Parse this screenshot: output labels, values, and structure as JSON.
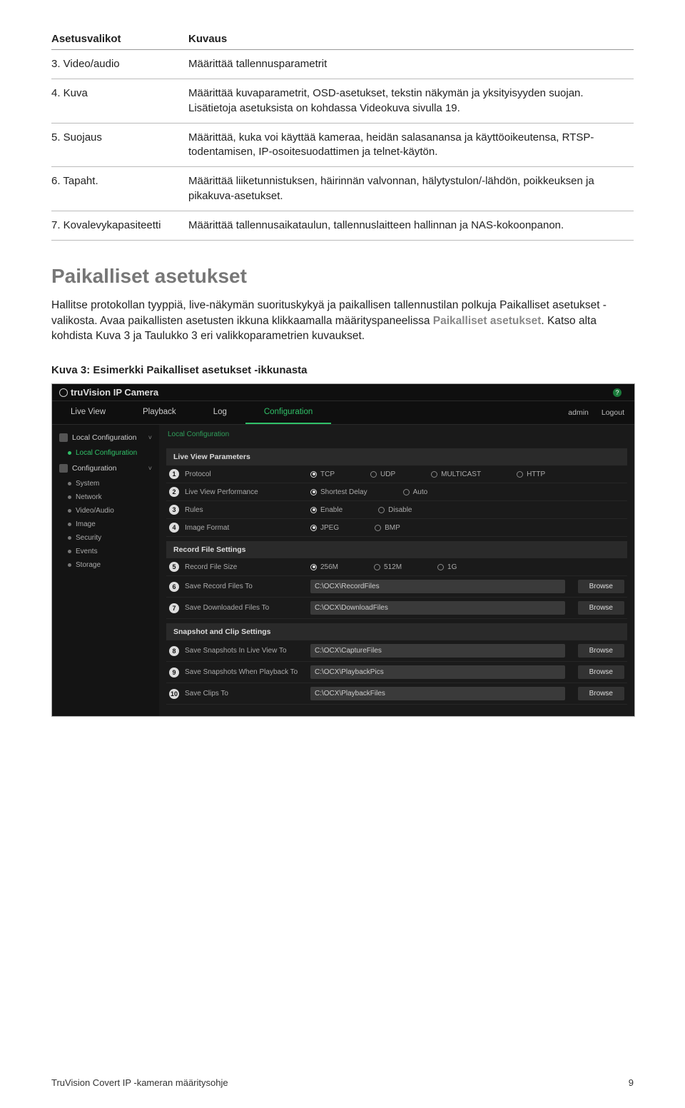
{
  "table": {
    "head1": "Asetusvalikot",
    "head2": "Kuvaus",
    "rows": [
      {
        "c1": "3. Video/audio",
        "c2": "Määrittää tallennusparametrit"
      },
      {
        "c1": "4. Kuva",
        "c2": "Määrittää kuvaparametrit, OSD-asetukset, tekstin näkymän ja yksityisyyden suojan. Lisätietoja asetuksista on kohdassa Videokuva sivulla 19."
      },
      {
        "c1": "5. Suojaus",
        "c2": "Määrittää, kuka voi käyttää kameraa, heidän salasanansa ja käyttöoikeutensa, RTSP-todentamisen, IP-osoitesuodattimen ja telnet-käytön."
      },
      {
        "c1": "6. Tapaht.",
        "c2": "Määrittää liiketunnistuksen, häirinnän valvonnan, hälytystulon/-lähdön, poikkeuksen ja pikakuva-asetukset."
      },
      {
        "c1": "7. Kovalevykapasiteetti",
        "c2": "Määrittää tallennusaikataulun, tallennuslaitteen hallinnan ja NAS-kokoonpanon."
      }
    ]
  },
  "section_title": "Paikalliset asetukset",
  "para_a": "Hallitse protokollan tyyppiä, live-näkymän suorituskykyä ja paikallisen tallennustilan polkuja Paikalliset asetukset -valikosta. Avaa paikallisten asetusten ikkuna klikkaamalla määrityspaneelissa ",
  "para_bold": "Paikalliset asetukset",
  "para_b": ". Katso alta kohdista Kuva 3 ja Taulukko 3 eri valikkoparametrien kuvaukset.",
  "fig_caption": "Kuva 3: Esimerkki Paikalliset asetukset -ikkunasta",
  "shot": {
    "logo": "truVision  IP Camera",
    "tabs": {
      "live": "Live View",
      "play": "Playback",
      "log": "Log",
      "conf": "Configuration"
    },
    "user": "admin",
    "logout": "Logout",
    "side": {
      "local": "Local Configuration",
      "local_item": "Local Configuration",
      "config": "Configuration",
      "items": [
        "System",
        "Network",
        "Video/Audio",
        "Image",
        "Security",
        "Events",
        "Storage"
      ]
    },
    "crumb": "Local Configuration",
    "g1": "Live View Parameters",
    "r1": {
      "l": "Protocol",
      "o": [
        "TCP",
        "UDP",
        "MULTICAST",
        "HTTP"
      ]
    },
    "r2": {
      "l": "Live View Performance",
      "o": [
        "Shortest Delay",
        "Auto"
      ]
    },
    "r3": {
      "l": "Rules",
      "o": [
        "Enable",
        "Disable"
      ]
    },
    "r4": {
      "l": "Image Format",
      "o": [
        "JPEG",
        "BMP"
      ]
    },
    "g2": "Record File Settings",
    "r5": {
      "l": "Record File Size",
      "o": [
        "256M",
        "512M",
        "1G"
      ]
    },
    "r6": {
      "l": "Save Record Files To",
      "p": "C:\\OCX\\RecordFiles"
    },
    "r7": {
      "l": "Save Downloaded Files To",
      "p": "C:\\OCX\\DownloadFiles"
    },
    "g3": "Snapshot and Clip Settings",
    "r8": {
      "l": "Save Snapshots In Live View To",
      "p": "C:\\OCX\\CaptureFiles"
    },
    "r9": {
      "l": "Save Snapshots When Playback To",
      "p": "C:\\OCX\\PlaybackPics"
    },
    "r10": {
      "l": "Save Clips To",
      "p": "C:\\OCX\\PlaybackFiles"
    },
    "browse": "Browse"
  },
  "footer_left": "TruVision Covert IP -kameran määritysohje",
  "footer_right": "9"
}
